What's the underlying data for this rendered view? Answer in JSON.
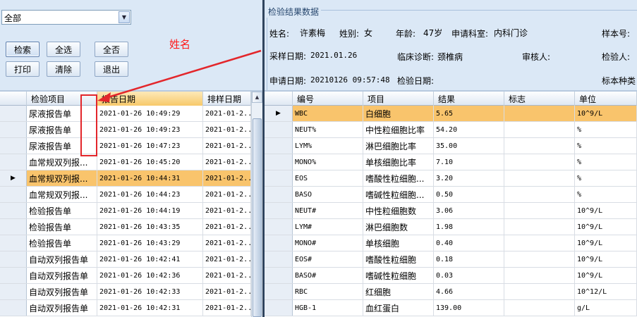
{
  "filter": {
    "selected": "全部"
  },
  "toolbar": {
    "search": "检索",
    "select_all": "全选",
    "select_none": "全否",
    "print": "打印",
    "clear": "清除",
    "exit": "退出"
  },
  "annotation": {
    "name_hint": "姓名"
  },
  "result_panel": {
    "title": "检验结果数据",
    "name_label": "姓名:",
    "name_value": "许素梅",
    "sex_label": "姓别:",
    "sex_value": "女",
    "age_label": "年龄:",
    "age_value": "47岁",
    "dept_label": "申请科室:",
    "dept_value": "内科门诊",
    "sample_no_label": "样本号:",
    "sample_date_label": "采样日期:",
    "sample_date_value": "2021.01.26",
    "diagnosis_label": "临床诊断:",
    "diagnosis_value": "颈椎病",
    "reviewer_label": "审核人:",
    "tester_label": "检验人:",
    "apply_date_label": "申请日期:",
    "apply_date_value": "20210126 09:57:48",
    "test_date_label": "检验日期:",
    "sample_type_label": "标本种类"
  },
  "left_grid": {
    "columns": [
      "检验项目",
      "报告日期",
      "排样日期"
    ],
    "rows": [
      {
        "item": "尿液报告单",
        "report": "2021-01-26 10:49:29",
        "sched": "2021-01-2..."
      },
      {
        "item": "尿液报告单",
        "report": "2021-01-26 10:49:23",
        "sched": "2021-01-2..."
      },
      {
        "item": "尿液报告单",
        "report": "2021-01-26 10:47:23",
        "sched": "2021-01-2..."
      },
      {
        "item": "血常规双列报...",
        "report": "2021-01-26 10:45:20",
        "sched": "2021-01-2..."
      },
      {
        "item": "血常规双列报...",
        "report": "2021-01-26 10:44:31",
        "sched": "2021-01-2..."
      },
      {
        "item": "血常规双列报...",
        "report": "2021-01-26 10:44:23",
        "sched": "2021-01-2..."
      },
      {
        "item": "检验报告单",
        "report": "2021-01-26 10:44:19",
        "sched": "2021-01-2..."
      },
      {
        "item": "检验报告单",
        "report": "2021-01-26 10:43:35",
        "sched": "2021-01-2..."
      },
      {
        "item": "检验报告单",
        "report": "2021-01-26 10:43:29",
        "sched": "2021-01-2..."
      },
      {
        "item": "自动双列报告单",
        "report": "2021-01-26 10:42:41",
        "sched": "2021-01-2..."
      },
      {
        "item": "自动双列报告单",
        "report": "2021-01-26 10:42:36",
        "sched": "2021-01-2..."
      },
      {
        "item": "自动双列报告单",
        "report": "2021-01-26 10:42:33",
        "sched": "2021-01-2..."
      },
      {
        "item": "自动双列报告单",
        "report": "2021-01-26 10:42:31",
        "sched": "2021-01-2..."
      }
    ]
  },
  "right_grid": {
    "columns": [
      "编号",
      "项目",
      "结果",
      "标志",
      "单位"
    ],
    "rows": [
      {
        "code": "WBC",
        "name": "白细胞",
        "result": "5.65",
        "flag": "",
        "unit": "10^9/L"
      },
      {
        "code": "NEUT%",
        "name": "中性粒细胞比率",
        "result": "54.20",
        "flag": "",
        "unit": "%"
      },
      {
        "code": "LYM%",
        "name": "淋巴细胞比率",
        "result": "35.00",
        "flag": "",
        "unit": "%"
      },
      {
        "code": "MONO%",
        "name": "单核细胞比率",
        "result": "7.10",
        "flag": "",
        "unit": "%"
      },
      {
        "code": "EOS",
        "name": "嗜酸性粒细胞...",
        "result": "3.20",
        "flag": "",
        "unit": "%"
      },
      {
        "code": "BASO",
        "name": "嗜碱性粒细胞...",
        "result": "0.50",
        "flag": "",
        "unit": "%"
      },
      {
        "code": "NEUT#",
        "name": "中性粒细胞数",
        "result": "3.06",
        "flag": "",
        "unit": "10^9/L"
      },
      {
        "code": "LYM#",
        "name": "淋巴细胞数",
        "result": "1.98",
        "flag": "",
        "unit": "10^9/L"
      },
      {
        "code": "MONO#",
        "name": "单核细胞",
        "result": "0.40",
        "flag": "",
        "unit": "10^9/L"
      },
      {
        "code": "EOS#",
        "name": "嗜酸性粒细胞",
        "result": "0.18",
        "flag": "",
        "unit": "10^9/L"
      },
      {
        "code": "BASO#",
        "name": "嗜碱性粒细胞",
        "result": "0.03",
        "flag": "",
        "unit": "10^9/L"
      },
      {
        "code": "RBC",
        "name": "红细胞",
        "result": "4.66",
        "flag": "",
        "unit": "10^12/L"
      },
      {
        "code": "HGB-1",
        "name": "血红蛋白",
        "result": "139.00",
        "flag": "",
        "unit": "g/L"
      }
    ]
  },
  "colors": {
    "selection": "#f9c46c",
    "panel_bg": "#dbe8f6",
    "annotation": "#e3262b"
  },
  "icons": {
    "row_pointer": "triangle-right-icon",
    "combo_dropdown": "chevron-down-icon"
  }
}
